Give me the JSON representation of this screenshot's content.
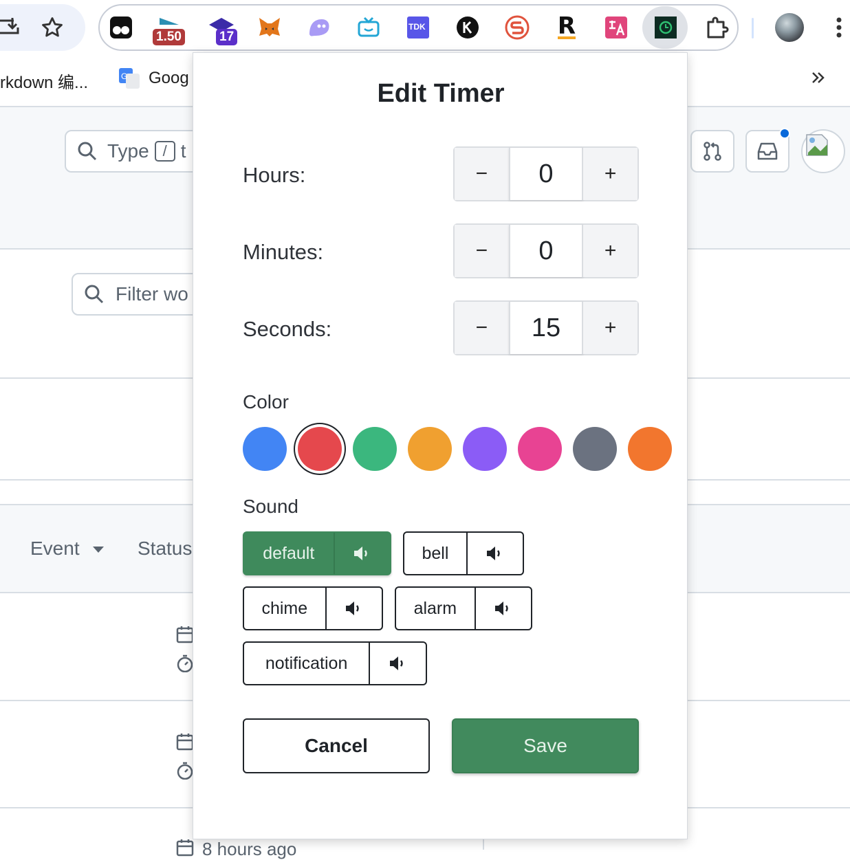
{
  "bookmarks": {
    "item1": "rkdown 编...",
    "item2": "Goog"
  },
  "extensions": {
    "badge_speed": "1.50",
    "badge_count": "17",
    "tdk_label": "TDK",
    "r_label": "R"
  },
  "page": {
    "search_text_before": "Type",
    "search_key": "/",
    "search_text_after": "t",
    "filter_placeholder": "Filter wo",
    "col_event": "Event",
    "col_status": "Status",
    "row_time": "8 hours ago"
  },
  "popup": {
    "title": "Edit Timer",
    "hours_label": "Hours:",
    "minutes_label": "Minutes:",
    "seconds_label": "Seconds:",
    "minus": "−",
    "plus": "+",
    "hours_value": "0",
    "minutes_value": "0",
    "seconds_value": "15",
    "color_label": "Color",
    "colors": [
      "#4285f4",
      "#e5484d",
      "#3bb77e",
      "#f0a030",
      "#8b5cf6",
      "#e84393",
      "#6b7280",
      "#f2762e"
    ],
    "selected_color_index": 1,
    "sound_label": "Sound",
    "sounds": [
      "default",
      "bell",
      "chime",
      "alarm",
      "notification"
    ],
    "selected_sound": "default",
    "cancel_label": "Cancel",
    "save_label": "Save"
  }
}
